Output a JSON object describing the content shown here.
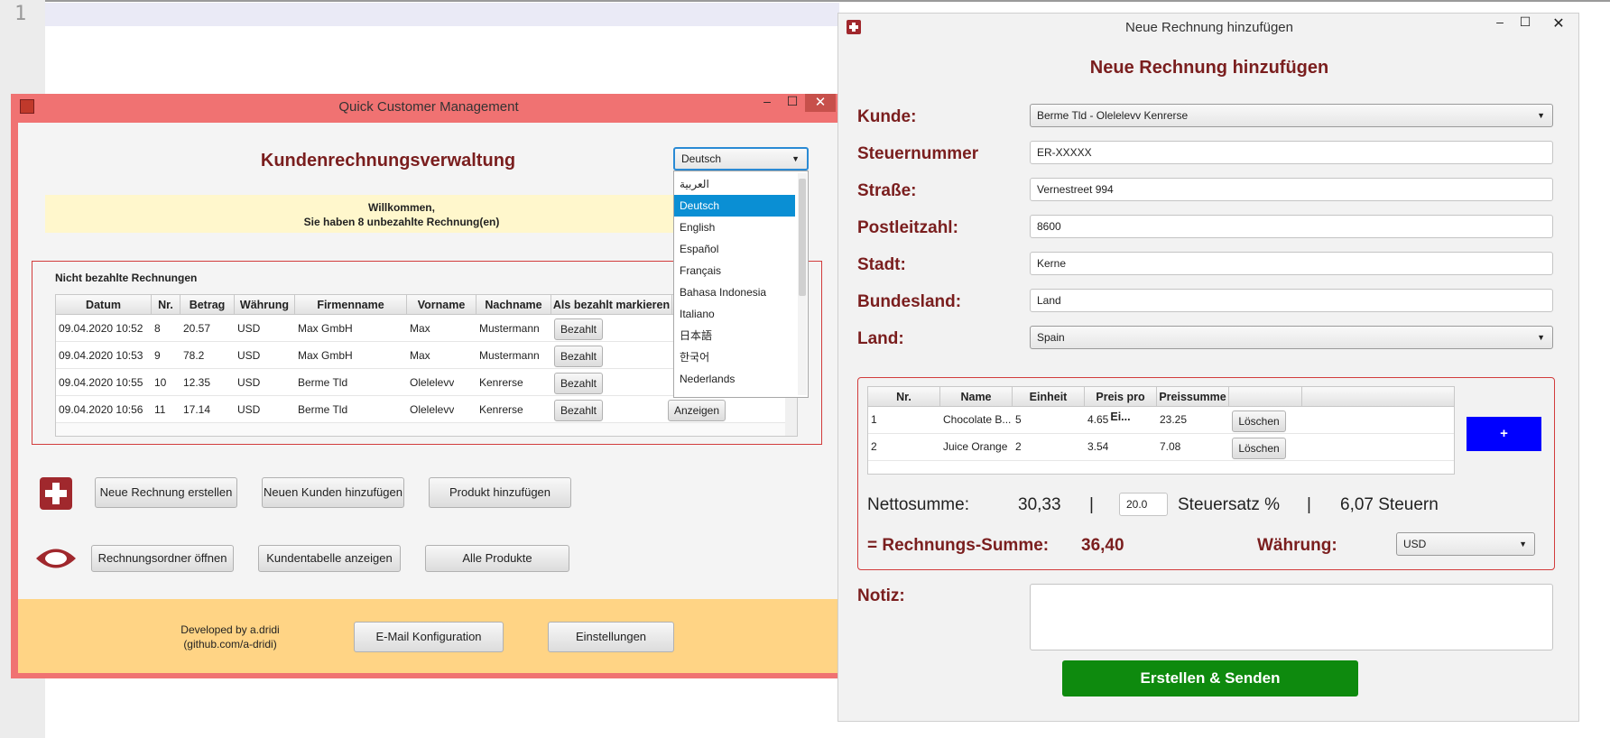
{
  "editor": {
    "line_number": "1"
  },
  "main_window": {
    "title": "Quick Customer Management",
    "heading": "Kundenrechnungsverwaltung",
    "welcome_line1": "Willkommen,",
    "welcome_line2": "Sie haben 8 unbezahlte Rechnung(en)",
    "language_select": {
      "value": "Deutsch",
      "options": [
        "العربية",
        "Deutsch",
        "English",
        "Español",
        "Français",
        "Bahasa Indonesia",
        "Italiano",
        "日本語",
        "한국어",
        "Nederlands"
      ],
      "selected_index": 1
    },
    "unpaid_title": "Nicht bezahlte Rechnungen",
    "columns": [
      "Datum",
      "Nr.",
      "Betrag",
      "Währung",
      "Firmenname",
      "Vorname",
      "Nachname",
      "Als bezahlt markieren"
    ],
    "rows": [
      {
        "datum": "09.04.2020 10:52",
        "nr": "8",
        "betrag": "20.57",
        "waehrung": "USD",
        "firma": "Max GmbH",
        "vorname": "Max",
        "nachname": "Mustermann",
        "bezahlt": "Bezahlt"
      },
      {
        "datum": "09.04.2020 10:53",
        "nr": "9",
        "betrag": "78.2",
        "waehrung": "USD",
        "firma": "Max GmbH",
        "vorname": "Max",
        "nachname": "Mustermann",
        "bezahlt": "Bezahlt"
      },
      {
        "datum": "09.04.2020 10:55",
        "nr": "10",
        "betrag": "12.35",
        "waehrung": "USD",
        "firma": "Berme Tld",
        "vorname": "Olelelevv",
        "nachname": "Kenrerse",
        "bezahlt": "Bezahlt"
      },
      {
        "datum": "09.04.2020 10:56",
        "nr": "11",
        "betrag": "17.14",
        "waehrung": "USD",
        "firma": "Berme Tld",
        "vorname": "Olelelevv",
        "nachname": "Kenrerse",
        "bezahlt": "Bezahlt",
        "anzeigen": "Anzeigen"
      }
    ],
    "buttons_row1": [
      "Neue Rechnung erstellen",
      "Neuen Kunden hinzufügen",
      "Produkt hinzufügen"
    ],
    "buttons_row2": [
      "Rechnungsordner öffnen",
      "Kundentabelle anzeigen",
      "Alle Produkte"
    ],
    "footer_text1": "Developed by a.dridi",
    "footer_text2": "(github.com/a-dridi)",
    "email_button": "E-Mail Konfiguration",
    "settings_button": "Einstellungen",
    "colors": {
      "frame": "#f07272",
      "footer": "#ffd485",
      "welcome": "#fff7cc",
      "accent": "#7a1e1e"
    }
  },
  "invoice_window": {
    "title": "Neue Rechnung hinzufügen",
    "heading": "Neue Rechnung hinzufügen",
    "labels": {
      "kunde": "Kunde:",
      "steuer": "Steuernummer",
      "strasse": "Straße:",
      "plz": "Postleitzahl:",
      "stadt": "Stadt:",
      "bundesland": "Bundesland:",
      "land": "Land:",
      "notiz": "Notiz:"
    },
    "values": {
      "kunde": "Berme Tld - Olelelevv Kenrerse",
      "steuer": "ER-XXXXX",
      "strasse": "Vernestreet 994",
      "plz": "8600",
      "stadt": "Kerne",
      "bundesland": "Land",
      "land": "Spain"
    },
    "product_columns": [
      "Nr.",
      "Name",
      "Einheit",
      "Preis pro Ei...",
      "Preissumme"
    ],
    "products": [
      {
        "nr": "1",
        "name": "Chocolate B...",
        "einheit": "5",
        "preis": "4.65",
        "summe": "23.25",
        "delete": "Löschen"
      },
      {
        "nr": "2",
        "name": "Juice Orange",
        "einheit": "2",
        "preis": "3.54",
        "summe": "7.08",
        "delete": "Löschen"
      }
    ],
    "add_button": "+",
    "netto_label": "Nettosumme:",
    "netto_value": "30,33",
    "separator": "|",
    "tax_rate": "20.0",
    "tax_label": "Steuersatz %",
    "tax_value": "6,07 Steuern",
    "total_label": "= Rechnungs-Summe:",
    "total_value": "36,40",
    "currency_label": "Währung:",
    "currency_value": "USD",
    "submit": "Erstellen & Senden"
  },
  "icons": [
    "app-icon",
    "minimize-icon",
    "maximize-icon",
    "close-icon",
    "chevron-down-icon",
    "red-cross-icon",
    "eye-icon"
  ]
}
